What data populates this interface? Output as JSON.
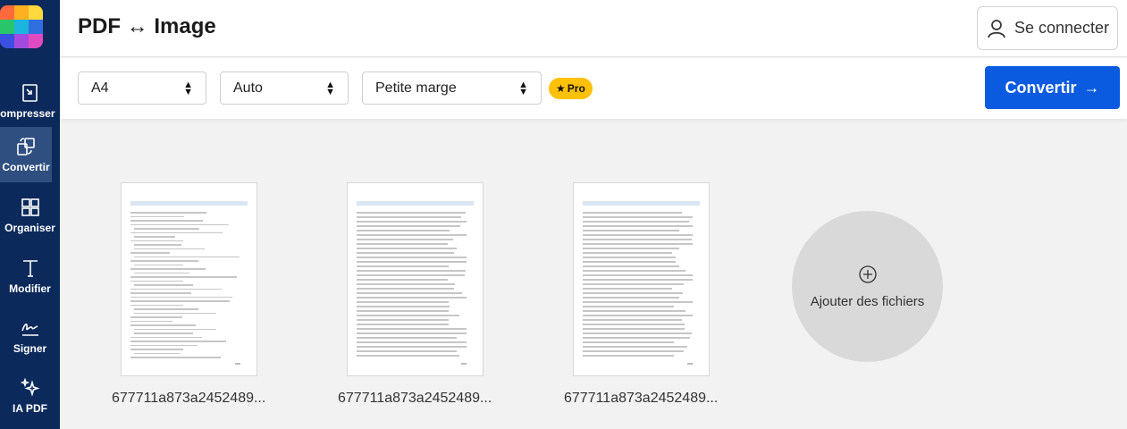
{
  "sidebar": {
    "logo_colors": [
      "#ff6a3d",
      "#ffb020",
      "#ffd93d",
      "#29c56a",
      "#1cb5e0",
      "#2f6fe0",
      "#3b4fe0",
      "#a34be0",
      "#e04bc2"
    ],
    "items": [
      {
        "label": "Compresser",
        "icon": "compress-icon"
      },
      {
        "label": "Convertir",
        "icon": "convert-icon"
      },
      {
        "label": "Organiser",
        "icon": "grid-icon"
      },
      {
        "label": "Modifier",
        "icon": "text-icon"
      },
      {
        "label": "Signer",
        "icon": "signature-icon"
      },
      {
        "label": "IA PDF",
        "icon": "sparkle-icon"
      }
    ]
  },
  "header": {
    "title": "PDF ↔ Image",
    "login_label": "Se connecter"
  },
  "toolbar": {
    "page_size": "A4",
    "orientation": "Auto",
    "margin": "Petite marge",
    "pro_label": "Pro",
    "convert_label": "Convertir",
    "convert_arrow": "→"
  },
  "colors": {
    "sidebar_bg": "#0b2a5b",
    "accent": "#0a5be0",
    "pro_badge": "#ffc107"
  },
  "files": [
    {
      "name": "677711a873a2452489..."
    },
    {
      "name": "677711a873a2452489..."
    },
    {
      "name": "677711a873a2452489..."
    }
  ],
  "add_files_label": "Ajouter des fichiers"
}
